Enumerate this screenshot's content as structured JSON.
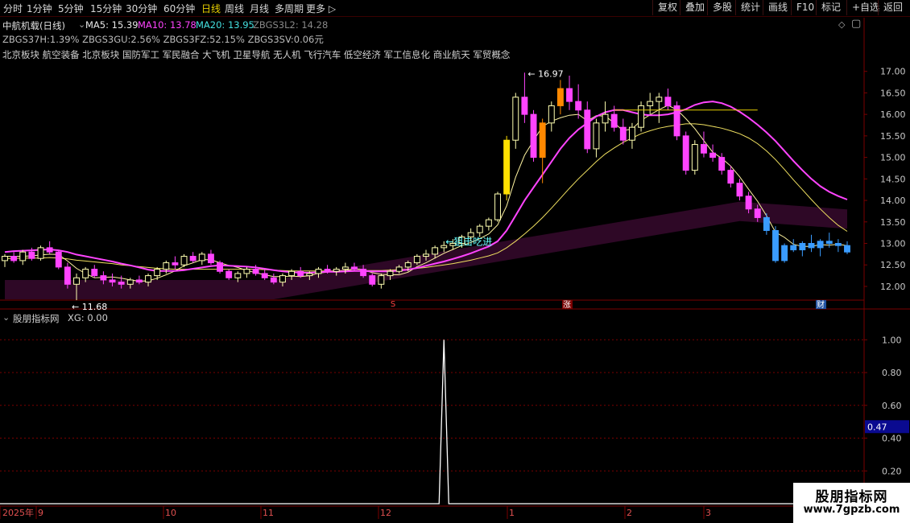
{
  "toolbar": {
    "timeframes": [
      "分时",
      "1分钟",
      "5分钟",
      "15分钟",
      "30分钟",
      "60分钟",
      "日线",
      "周线",
      "月线",
      "多周期",
      "更多"
    ],
    "active": "日线",
    "buttons": [
      "复权",
      "叠加",
      "多股",
      "统计",
      "画线",
      "F10",
      "标记",
      "+自选",
      "返回"
    ]
  },
  "header": {
    "title": "中航机载(日线)",
    "ma5": "MA5: 15.39",
    "ma10": "MA10: 13.78",
    "ma20": "MA20: 13.95",
    "zbg3l2": "ZBGS3L2: 14.28",
    "line2": "ZBGS37H:1.39% ZBGS3GU:2.56% ZBGS3FZ:52.15% ZBGS3SV:0.06元",
    "sectors": "北京板块 航空装备 北京板块 国防军工 军民融合 大飞机 卫星导航 无人机 飞行汽车 低空经济 军工信息化 商业航天 军贸概念"
  },
  "annotations": {
    "high": "16.97",
    "low": "11.68",
    "signal": "←狙击吃进",
    "mark_s": "S",
    "mark_zhang": "涨",
    "mark_cai": "财"
  },
  "indicator": {
    "title": "股朋指标网",
    "xg": "XG: 0.00",
    "current": "0.47"
  },
  "xaxis": [
    "2025年",
    "9",
    "10",
    "11",
    "12",
    "1",
    "2",
    "3"
  ],
  "watermark": {
    "line1": "股朋指标网",
    "line2": "www.7gpzb.com"
  },
  "colors": {
    "up": "#ff44ff",
    "down": "#ffffb0",
    "ma5": "#ffffff",
    "ma10": "#ff44ff",
    "ma20": "#ffff80",
    "blue": "#3a9cff"
  },
  "chart_data": [
    {
      "type": "candlestick",
      "title": "中航机载(日线)",
      "ylim": [
        11.7,
        17.2
      ],
      "yticks": [
        12.0,
        12.5,
        13.0,
        13.5,
        14.0,
        14.5,
        15.0,
        15.5,
        16.0,
        16.5,
        17.0
      ],
      "ohlc": [
        [
          12.6,
          12.75,
          12.45,
          12.7
        ],
        [
          12.7,
          12.8,
          12.55,
          12.6
        ],
        [
          12.6,
          12.85,
          12.5,
          12.8
        ],
        [
          12.8,
          12.9,
          12.6,
          12.65
        ],
        [
          12.65,
          12.95,
          12.6,
          12.9
        ],
        [
          12.9,
          13.05,
          12.75,
          12.8
        ],
        [
          12.8,
          12.85,
          12.4,
          12.45
        ],
        [
          12.45,
          12.55,
          11.95,
          12.05
        ],
        [
          12.05,
          12.3,
          11.68,
          12.2
        ],
        [
          12.2,
          12.45,
          12.1,
          12.4
        ],
        [
          12.4,
          12.5,
          12.2,
          12.25
        ],
        [
          12.25,
          12.35,
          12.05,
          12.15
        ],
        [
          12.15,
          12.3,
          12.0,
          12.1
        ],
        [
          12.1,
          12.25,
          11.95,
          12.05
        ],
        [
          12.05,
          12.2,
          11.95,
          12.15
        ],
        [
          12.15,
          12.25,
          12.05,
          12.1
        ],
        [
          12.1,
          12.3,
          12.0,
          12.25
        ],
        [
          12.25,
          12.45,
          12.15,
          12.4
        ],
        [
          12.4,
          12.6,
          12.3,
          12.55
        ],
        [
          12.55,
          12.7,
          12.4,
          12.5
        ],
        [
          12.5,
          12.75,
          12.45,
          12.7
        ],
        [
          12.7,
          12.8,
          12.55,
          12.6
        ],
        [
          12.6,
          12.8,
          12.5,
          12.75
        ],
        [
          12.75,
          12.85,
          12.5,
          12.55
        ],
        [
          12.55,
          12.6,
          12.3,
          12.35
        ],
        [
          12.35,
          12.4,
          12.15,
          12.2
        ],
        [
          12.2,
          12.35,
          12.1,
          12.3
        ],
        [
          12.3,
          12.45,
          12.2,
          12.4
        ],
        [
          12.4,
          12.5,
          12.25,
          12.3
        ],
        [
          12.3,
          12.4,
          12.15,
          12.2
        ],
        [
          12.2,
          12.3,
          12.05,
          12.1
        ],
        [
          12.1,
          12.3,
          12.0,
          12.25
        ],
        [
          12.25,
          12.4,
          12.15,
          12.35
        ],
        [
          12.35,
          12.45,
          12.2,
          12.25
        ],
        [
          12.25,
          12.35,
          12.15,
          12.3
        ],
        [
          12.3,
          12.45,
          12.2,
          12.4
        ],
        [
          12.4,
          12.5,
          12.3,
          12.35
        ],
        [
          12.35,
          12.45,
          12.25,
          12.4
        ],
        [
          12.4,
          12.55,
          12.3,
          12.45
        ],
        [
          12.45,
          12.55,
          12.35,
          12.4
        ],
        [
          12.4,
          12.5,
          12.2,
          12.25
        ],
        [
          12.25,
          12.3,
          12.0,
          12.05
        ],
        [
          12.05,
          12.3,
          11.95,
          12.25
        ],
        [
          12.25,
          12.4,
          12.15,
          12.35
        ],
        [
          12.35,
          12.5,
          12.3,
          12.45
        ],
        [
          12.45,
          12.6,
          12.35,
          12.55
        ],
        [
          12.55,
          12.75,
          12.5,
          12.7
        ],
        [
          12.7,
          12.85,
          12.6,
          12.75
        ],
        [
          12.75,
          12.95,
          12.65,
          12.9
        ],
        [
          12.9,
          13.05,
          12.8,
          12.95
        ],
        [
          12.95,
          13.1,
          12.85,
          13.0
        ],
        [
          13.0,
          13.2,
          12.9,
          13.15
        ],
        [
          13.15,
          13.35,
          13.05,
          13.25
        ],
        [
          13.25,
          13.45,
          13.15,
          13.4
        ],
        [
          13.4,
          13.6,
          13.3,
          13.55
        ],
        [
          13.55,
          14.2,
          13.5,
          14.15
        ],
        [
          14.15,
          15.5,
          14.0,
          15.4
        ],
        [
          15.4,
          16.5,
          15.2,
          16.4
        ],
        [
          16.4,
          16.97,
          15.8,
          16.0
        ],
        [
          16.0,
          16.1,
          14.9,
          15.0
        ],
        [
          15.0,
          15.9,
          14.4,
          15.8
        ],
        [
          15.8,
          16.3,
          15.6,
          16.2
        ],
        [
          16.2,
          16.8,
          16.0,
          16.6
        ],
        [
          16.6,
          16.9,
          16.1,
          16.3
        ],
        [
          16.3,
          16.7,
          15.9,
          16.1
        ],
        [
          16.1,
          16.3,
          15.1,
          15.2
        ],
        [
          15.2,
          15.9,
          15.0,
          15.8
        ],
        [
          15.8,
          16.3,
          15.6,
          16.0
        ],
        [
          16.0,
          16.2,
          15.6,
          15.7
        ],
        [
          15.7,
          15.9,
          15.3,
          15.4
        ],
        [
          15.4,
          15.8,
          15.2,
          15.7
        ],
        [
          15.7,
          16.3,
          15.6,
          16.2
        ],
        [
          16.2,
          16.5,
          16.0,
          16.3
        ],
        [
          16.3,
          16.5,
          15.8,
          16.4
        ],
        [
          16.4,
          16.6,
          16.1,
          16.2
        ],
        [
          16.2,
          16.3,
          15.4,
          15.5
        ],
        [
          15.5,
          15.6,
          14.6,
          14.7
        ],
        [
          14.7,
          15.4,
          14.6,
          15.3
        ],
        [
          15.3,
          15.6,
          15.0,
          15.1
        ],
        [
          15.1,
          15.3,
          14.9,
          15.0
        ],
        [
          15.0,
          15.1,
          14.6,
          14.7
        ],
        [
          14.7,
          14.8,
          14.3,
          14.4
        ],
        [
          14.4,
          14.5,
          14.0,
          14.1
        ],
        [
          14.1,
          14.2,
          13.7,
          13.8
        ],
        [
          13.8,
          13.9,
          13.5,
          13.6
        ],
        [
          13.6,
          13.7,
          13.2,
          13.3
        ],
        [
          13.3,
          13.4,
          12.55,
          12.6
        ],
        [
          12.6,
          13.0,
          12.55,
          12.95
        ],
        [
          12.95,
          13.1,
          12.8,
          12.85
        ],
        [
          12.85,
          13.05,
          12.7,
          13.0
        ],
        [
          13.0,
          13.2,
          12.8,
          12.9
        ],
        [
          12.9,
          13.1,
          12.7,
          13.05
        ],
        [
          13.05,
          13.25,
          12.9,
          13.0
        ],
        [
          13.0,
          13.1,
          12.8,
          12.95
        ],
        [
          12.95,
          13.05,
          12.75,
          12.8
        ]
      ],
      "ma10": [
        12.8,
        12.82,
        12.83,
        12.84,
        12.85,
        12.86,
        12.84,
        12.8,
        12.74,
        12.7,
        12.66,
        12.62,
        12.58,
        12.53,
        12.49,
        12.44,
        12.39,
        12.36,
        12.36,
        12.36,
        12.38,
        12.41,
        12.44,
        12.47,
        12.49,
        12.48,
        12.47,
        12.46,
        12.44,
        12.41,
        12.38,
        12.35,
        12.33,
        12.32,
        12.32,
        12.33,
        12.34,
        12.34,
        12.35,
        12.36,
        12.36,
        12.35,
        12.35,
        12.35,
        12.37,
        12.39,
        12.43,
        12.48,
        12.53,
        12.58,
        12.64,
        12.7,
        12.77,
        12.85,
        12.93,
        13.05,
        13.3,
        13.65,
        14.0,
        14.3,
        14.6,
        14.9,
        15.2,
        15.45,
        15.65,
        15.8,
        15.95,
        16.05,
        16.1,
        16.1,
        16.05,
        16.0,
        15.98,
        15.98,
        16.0,
        16.05,
        16.12,
        16.22,
        16.28,
        16.3,
        16.26,
        16.18,
        16.06,
        15.92,
        15.76,
        15.58,
        15.38,
        15.15,
        14.92,
        14.7,
        14.5,
        14.33,
        14.2,
        14.1,
        14.02
      ],
      "ma20": [
        12.65,
        12.65,
        12.66,
        12.66,
        12.66,
        12.67,
        12.66,
        12.64,
        12.61,
        12.59,
        12.57,
        12.55,
        12.53,
        12.5,
        12.48,
        12.46,
        12.44,
        12.42,
        12.41,
        12.4,
        12.4,
        12.4,
        12.4,
        12.4,
        12.4,
        12.4,
        12.4,
        12.4,
        12.4,
        12.39,
        12.38,
        12.37,
        12.36,
        12.36,
        12.36,
        12.36,
        12.36,
        12.36,
        12.37,
        12.37,
        12.37,
        12.37,
        12.37,
        12.38,
        12.39,
        12.4,
        12.42,
        12.44,
        12.47,
        12.5,
        12.53,
        12.57,
        12.61,
        12.66,
        12.71,
        12.78,
        12.9,
        13.05,
        13.22,
        13.4,
        13.6,
        13.82,
        14.05,
        14.28,
        14.5,
        14.7,
        14.9,
        15.08,
        15.22,
        15.35,
        15.45,
        15.55,
        15.62,
        15.68,
        15.72,
        15.75,
        15.78,
        15.78,
        15.76,
        15.72,
        15.68,
        15.62,
        15.55,
        15.45,
        15.32,
        15.15,
        14.95,
        14.72,
        14.48,
        14.25,
        14.02,
        13.8,
        13.6,
        13.42,
        13.28
      ],
      "ma5": [
        12.7,
        12.7,
        12.7,
        12.71,
        12.73,
        12.75,
        12.74,
        12.59,
        12.42,
        12.3,
        12.2,
        12.21,
        12.22,
        12.19,
        12.15,
        12.12,
        12.13,
        12.19,
        12.27,
        12.36,
        12.48,
        12.55,
        12.62,
        12.62,
        12.55,
        12.49,
        12.44,
        12.37,
        12.32,
        12.27,
        12.23,
        12.23,
        12.24,
        12.23,
        12.25,
        12.31,
        12.33,
        12.35,
        12.37,
        12.41,
        12.39,
        12.32,
        12.28,
        12.27,
        12.27,
        12.33,
        12.46,
        12.55,
        12.66,
        12.77,
        12.86,
        12.95,
        13.02,
        13.11,
        13.22,
        13.43,
        13.87,
        14.54,
        15.05,
        15.39,
        15.72,
        15.84,
        15.92,
        15.98,
        16.0,
        15.85,
        15.97,
        15.96,
        15.8,
        15.62,
        15.66,
        15.86,
        15.99,
        16.11,
        16.21,
        16.11,
        15.9,
        15.67,
        15.39,
        15.12,
        14.98,
        14.8,
        14.55,
        14.26,
        13.98,
        13.64,
        13.26,
        13.14,
        12.98,
        12.93,
        12.93,
        12.97,
        12.96,
        12.98,
        12.95
      ]
    },
    {
      "type": "line",
      "title": "股朋指标网 XG",
      "ylim": [
        0,
        1.08
      ],
      "yticks": [
        0.2,
        0.4,
        0.6,
        0.8,
        1.0
      ],
      "signal_index": 49,
      "values_note": "XG 0 except 1 at signal bar"
    }
  ]
}
